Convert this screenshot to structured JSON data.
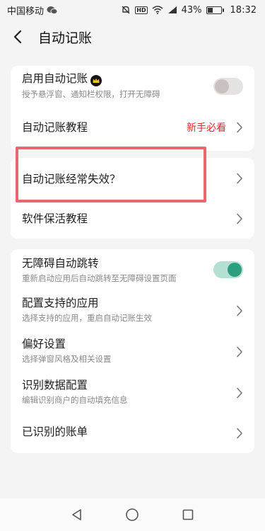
{
  "status_bar": {
    "carrier": "中国移动",
    "battery": "43%",
    "battery_level": 0.43,
    "time": "18:32",
    "hd_label": "HD"
  },
  "header": {
    "title": "自动记账"
  },
  "card1": {
    "enable_auto": {
      "title": "启用自动记账",
      "subtitle": "授予悬浮窗、通知栏权限，打开无障碍",
      "toggle_on": false
    },
    "tutorial": {
      "title": "自动记账教程",
      "badge": "新手必看",
      "badge_color": "#e0282a"
    }
  },
  "card2": {
    "failure": {
      "title": "自动记账经常失效？"
    },
    "keepalive": {
      "title": "软件保活教程"
    }
  },
  "card3": {
    "accessibility_jump": {
      "title": "无障碍自动跳转",
      "subtitle": "重新启动应用后自动跳转至无障碍设置页面",
      "toggle_on": true,
      "toggle_color": "#2e9e7e"
    },
    "supported_apps": {
      "title": "配置支持的应用",
      "subtitle": "选择支持的应用，重启自动记账生效"
    },
    "preferences": {
      "title": "偏好设置",
      "subtitle": "选择弹窗风格及相关设置"
    },
    "recognition_data": {
      "title": "识别数据配置",
      "subtitle": "编辑识别商户的自动填充信息"
    },
    "recognized_bills": {
      "title": "已识别的账单"
    }
  },
  "highlight_color": "#e8686f",
  "nav_bar": {
    "icons": [
      "back-triangle-icon",
      "home-circle-icon",
      "recents-square-icon"
    ]
  }
}
